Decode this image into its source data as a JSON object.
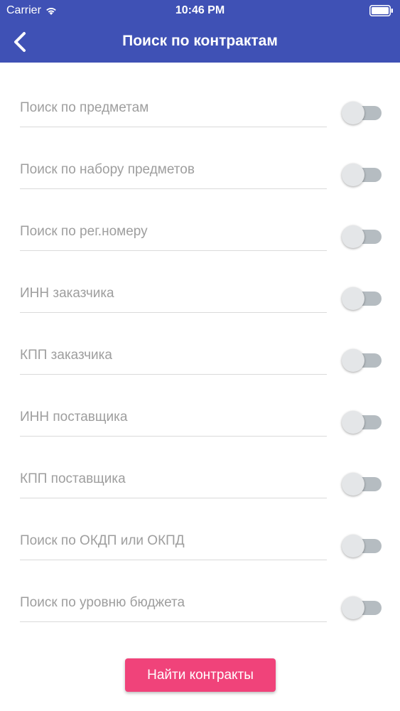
{
  "status_bar": {
    "carrier": "Carrier",
    "time": "10:46 PM",
    "icons": [
      "wifi-icon",
      "battery-icon"
    ]
  },
  "navbar": {
    "title": "Поиск по контрактам",
    "back_icon": "chevron-left-icon",
    "background_color": "#3f51b5"
  },
  "filters": [
    {
      "label": "Поиск по предметам",
      "enabled": false
    },
    {
      "label": "Поиск по набору предметов",
      "enabled": false
    },
    {
      "label": "Поиск по рег.номеру",
      "enabled": false
    },
    {
      "label": "ИНН заказчика",
      "enabled": false
    },
    {
      "label": "КПП заказчика",
      "enabled": false
    },
    {
      "label": "ИНН поставщика",
      "enabled": false
    },
    {
      "label": "КПП поставщика",
      "enabled": false
    },
    {
      "label": "Поиск по ОКДП или ОКПД",
      "enabled": false
    },
    {
      "label": "Поиск по уровню бюджета",
      "enabled": false
    }
  ],
  "search_button": {
    "label": "Найти контракты",
    "color": "#f0437a"
  }
}
